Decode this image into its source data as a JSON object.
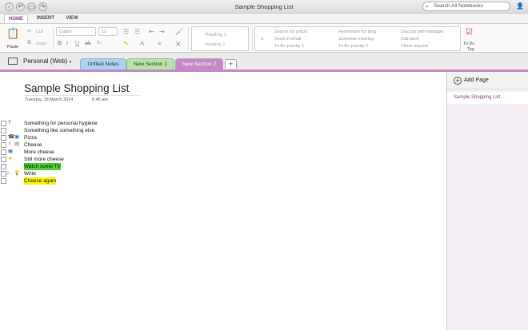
{
  "window": {
    "title": "Sample Shopping List"
  },
  "search": {
    "placeholder": "Search All Notebooks"
  },
  "ribbon_tabs": [
    "HOME",
    "INSERT",
    "VIEW"
  ],
  "ribbon": {
    "paste": "Paste",
    "cut": "Cut",
    "copy": "Copy",
    "font": "Calibri",
    "size": "11",
    "styles": [
      "Heading 1",
      "Heading 2"
    ],
    "tags_col1": [
      "Source for article",
      "Send in email",
      "To Do priority 1"
    ],
    "tags_col2": [
      "Remember for blog",
      "Schedule meeting",
      "To Do priority 2"
    ],
    "tags_col3": [
      "Discuss with manager",
      "Call back",
      "Client request"
    ],
    "todo_tag": [
      "To Do",
      "Tag"
    ]
  },
  "notebook": {
    "name": "Personal (Web)",
    "sections": [
      {
        "label": "Unfiled Notes",
        "color": "#a9d3ee"
      },
      {
        "label": "New Section 1",
        "color": "#b6e5a8"
      },
      {
        "label": "New Section 2",
        "color": "#c689c6"
      }
    ]
  },
  "page": {
    "title": "Sample Shopping List",
    "date": "Tuesday, 18 March 2014",
    "time": "6:46 am",
    "notes": [
      {
        "text": "Something for personal hygiene",
        "tags": [
          "?"
        ]
      },
      {
        "text": "Something like something else",
        "tags": []
      },
      {
        "text": "Pizza",
        "tags": [
          "phone",
          "contact"
        ]
      },
      {
        "text": "Cheese",
        "tags": [
          "!",
          "card"
        ]
      },
      {
        "text": "More cheese",
        "tags": [
          "person"
        ]
      },
      {
        "text": "Still more cheese",
        "tags": [
          "star"
        ]
      },
      {
        "text": "Watch some TV",
        "tags": [],
        "highlight": "#4cd137"
      },
      {
        "text": "Write",
        "tags": [
          "house",
          "bulb"
        ]
      },
      {
        "text": "Cheese again",
        "tags": [],
        "highlight": "#f7f500"
      }
    ]
  },
  "pages_panel": {
    "add_page": "Add Page",
    "pages": [
      "Sample Shopping List"
    ]
  }
}
